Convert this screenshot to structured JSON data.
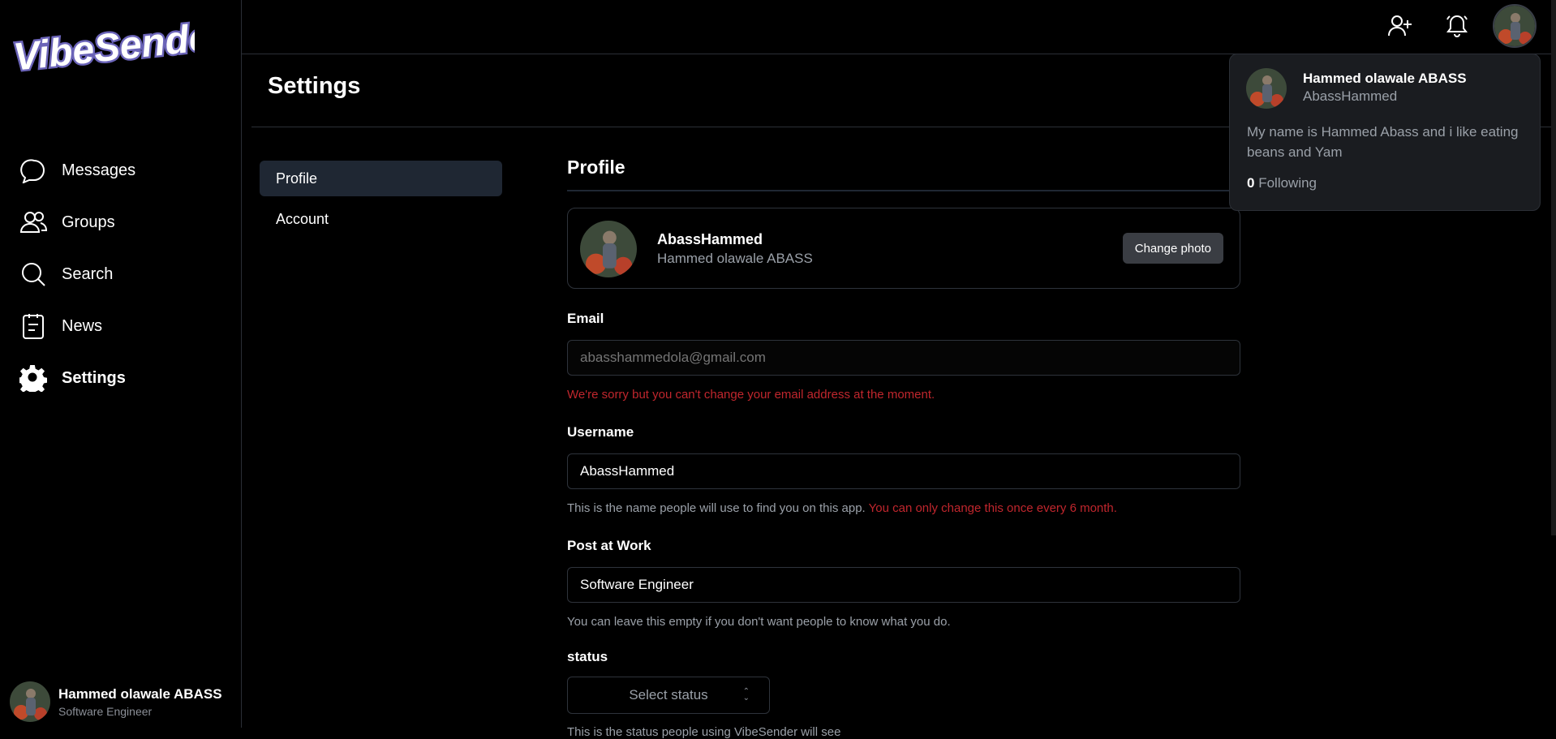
{
  "app": {
    "logo_text": "VibeSender"
  },
  "sidebar": {
    "items": [
      {
        "label": "Messages",
        "icon": "chat-bubble-icon",
        "active": false
      },
      {
        "label": "Groups",
        "icon": "users-icon",
        "active": false
      },
      {
        "label": "Search",
        "icon": "search-icon",
        "active": false
      },
      {
        "label": "News",
        "icon": "clipboard-icon",
        "active": false
      },
      {
        "label": "Settings",
        "icon": "gear-icon",
        "active": true
      }
    ],
    "user": {
      "name": "Hammed olawale ABASS",
      "role": "Software Engineer"
    }
  },
  "topbar": {
    "icons": [
      "add-user-icon",
      "bell-icon",
      "avatar"
    ]
  },
  "page": {
    "title": "Settings"
  },
  "subnav": {
    "items": [
      {
        "label": "Profile",
        "active": true
      },
      {
        "label": "Account",
        "active": false
      }
    ]
  },
  "profile": {
    "section_title": "Profile",
    "card": {
      "username": "AbassHammed",
      "full_name": "Hammed olawale ABASS",
      "change_photo_label": "Change photo"
    },
    "email": {
      "label": "Email",
      "placeholder": "abasshammedola@gmail.com",
      "error": "We're sorry but you can't change your email address at the moment."
    },
    "username": {
      "label": "Username",
      "value": "AbassHammed",
      "help": "This is the name people will use to find you on this app.",
      "warning": "You can only change this once every 6 month."
    },
    "post": {
      "label": "Post at Work",
      "value": "Software Engineer",
      "help": "You can leave this empty if you don't want people to know what you do."
    },
    "status": {
      "label": "status",
      "selected": "Select status",
      "help": "This is the status people using VibeSender will see"
    }
  },
  "popover": {
    "name": "Hammed olawale ABASS",
    "username": "AbassHammed",
    "bio": "My name is Hammed Abass and i like eating beans and Yam",
    "following_count": "0",
    "following_label": "Following"
  },
  "colors": {
    "background": "#000000",
    "panel": "#1a1c20",
    "active_nav": "#1f2733",
    "error": "#c0262d",
    "muted": "#9aa0a8"
  }
}
